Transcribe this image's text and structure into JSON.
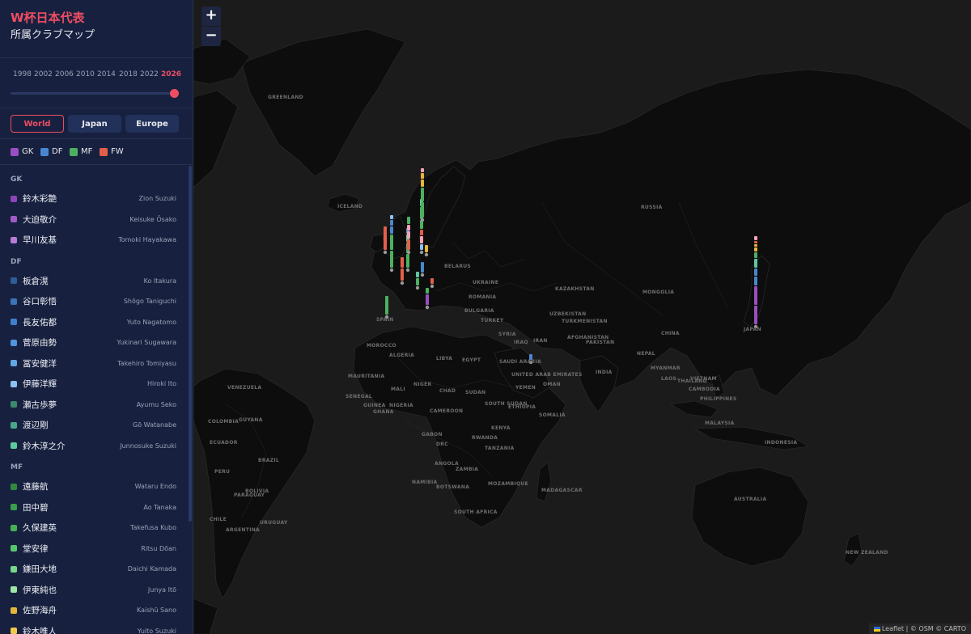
{
  "header": {
    "title": "W杯日本代表",
    "subtitle": "所属クラブマップ"
  },
  "years": [
    "1998",
    "2002",
    "2006",
    "2010",
    "2014",
    "2018",
    "2022",
    "2026"
  ],
  "selected_year": "2026",
  "scope_buttons": [
    "World",
    "Japan",
    "Europe"
  ],
  "selected_scope": "World",
  "legend": [
    {
      "label": "GK",
      "color": "#9a4fc0"
    },
    {
      "label": "DF",
      "color": "#4a86d0"
    },
    {
      "label": "MF",
      "color": "#4db060"
    },
    {
      "label": "FW",
      "color": "#e2604a"
    }
  ],
  "groups": [
    {
      "label": "GK",
      "players": [
        {
          "jp": "鈴木彩艶",
          "en": "Zion Suzuki",
          "color": "#8e44b8"
        },
        {
          "jp": "大迫敬介",
          "en": "Keisuke Ōsako",
          "color": "#a25ac8"
        },
        {
          "jp": "早川友基",
          "en": "Tomoki Hayakawa",
          "color": "#b57cd6"
        }
      ]
    },
    {
      "label": "DF",
      "players": [
        {
          "jp": "板倉滉",
          "en": "Ko Itakura",
          "color": "#2f5d9a"
        },
        {
          "jp": "谷口彰悟",
          "en": "Shōgo Taniguchi",
          "color": "#3b73b8"
        },
        {
          "jp": "長友佑都",
          "en": "Yuto Nagatomo",
          "color": "#3f80cc"
        },
        {
          "jp": "菅原由勢",
          "en": "Yukinari Sugawara",
          "color": "#4f94de"
        },
        {
          "jp": "冨安健洋",
          "en": "Takehiro Tomiyasu",
          "color": "#62a6e6"
        },
        {
          "jp": "伊藤洋輝",
          "en": "Hiroki Ito",
          "color": "#8cc2ef"
        },
        {
          "jp": "瀬古歩夢",
          "en": "Ayumu Seko",
          "color": "#3a8a6c"
        },
        {
          "jp": "渡辺剛",
          "en": "Gō Watanabe",
          "color": "#4aa88a"
        },
        {
          "jp": "鈴木淳之介",
          "en": "Junnosuke Suzuki",
          "color": "#5ec8a0"
        }
      ]
    },
    {
      "label": "MF",
      "players": [
        {
          "jp": "遠藤航",
          "en": "Wataru Endo",
          "color": "#2f8a3e"
        },
        {
          "jp": "田中碧",
          "en": "Ao Tanaka",
          "color": "#3a9e4a"
        },
        {
          "jp": "久保建英",
          "en": "Takefusa Kubo",
          "color": "#45b156"
        },
        {
          "jp": "堂安律",
          "en": "Ritsu Dōan",
          "color": "#56c66c"
        },
        {
          "jp": "鎌田大地",
          "en": "Daichi Kamada",
          "color": "#77d68a"
        },
        {
          "jp": "伊東純也",
          "en": "Junya Itō",
          "color": "#9fe6a6"
        },
        {
          "jp": "佐野海舟",
          "en": "Kaishū Sano",
          "color": "#e6b63c"
        },
        {
          "jp": "鈴木唯人",
          "en": "Yuito Suzuki",
          "color": "#f2c94c"
        }
      ]
    }
  ],
  "map": {
    "zoom_in": "+",
    "zoom_out": "−",
    "attribution_leaflet": "Leaflet",
    "attribution_rest": "| © OSM © CARTO",
    "labels": [
      "GREENLAND",
      "RUSSIA",
      "ICELAND",
      "BELARUS",
      "UKRAINE",
      "KAZAKHSTAN",
      "MONGOLIA",
      "ROMANIA",
      "BULGARIA",
      "TURKEY",
      "UZBEKISTAN",
      "TURKMENISTAN",
      "SPAIN",
      "CHINA",
      "AFGHANISTAN",
      "SYRIA",
      "IRAQ",
      "IRAN",
      "PAKISTAN",
      "NEPAL",
      "MOROCCO",
      "ALGERIA",
      "LIBYA",
      "EGYPT",
      "SAUDI ARABIA",
      "YEMEN",
      "INDIA",
      "MYANMAR",
      "LAOS",
      "VIETNAM",
      "PHILIPPINES",
      "UNITED ARAB EMIRATES",
      "MAURITANIA",
      "MALI",
      "NIGER",
      "CHAD",
      "SUDAN",
      "ETHIOPIA",
      "SOUTH SUDAN",
      "SENEGAL",
      "GUINEA",
      "NIGERIA",
      "KENYA",
      "TANZANIA",
      "GABON",
      "DRC",
      "ANGOLA",
      "ZAMBIA",
      "NAMIBIA",
      "BOTSWANA",
      "SOUTH AFRICA",
      "MOZAMBIQUE",
      "MADAGASCAR",
      "RWANDA",
      "INDONESIA",
      "MALAYSIA",
      "JAPAN",
      "VENEZUELA",
      "COLOMBIA",
      "GUYANA",
      "ECUADOR",
      "PERU",
      "BRAZIL",
      "BOLIVIA",
      "PARAGUAY",
      "CHILE",
      "ARGENTINA",
      "URUGUAY",
      "AUSTRALIA",
      "NEW ZEALAND",
      "THAILAND",
      "CAMBODIA",
      "GHANA",
      "CAMEROON",
      "SOMALIA",
      "OMAN"
    ]
  }
}
